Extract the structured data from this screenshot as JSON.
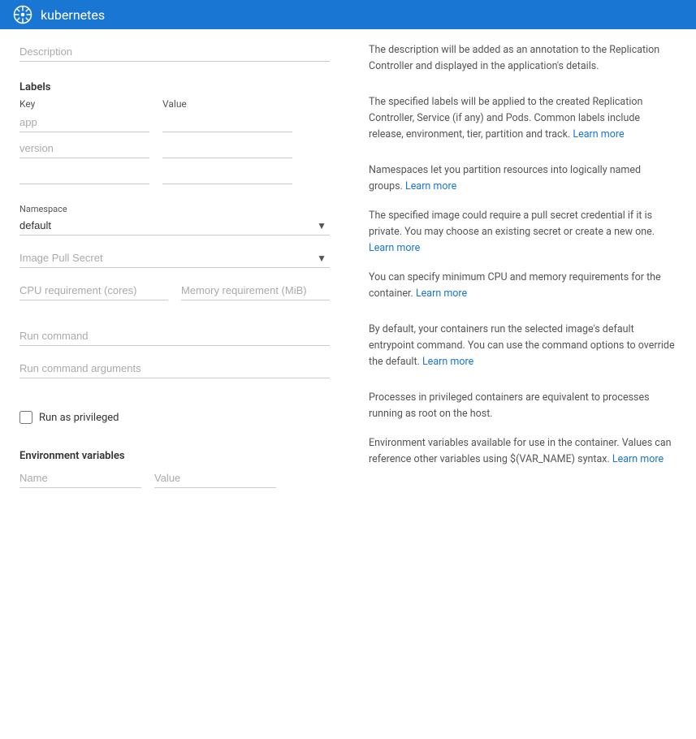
{
  "header": {
    "logo_alt": "Kubernetes logo",
    "title": "kubernetes"
  },
  "form": {
    "description_placeholder": "Description",
    "labels": {
      "section_label": "Labels",
      "key_header": "Key",
      "value_header": "Value",
      "row1_key_placeholder": "app",
      "row1_value_placeholder": "",
      "row2_key_placeholder": "version",
      "row2_value_placeholder": "",
      "row3_key_placeholder": "",
      "row3_value_placeholder": ""
    },
    "namespace": {
      "label": "Namespace",
      "selected": "default",
      "options": [
        "default"
      ]
    },
    "image_pull_secret": {
      "placeholder": "Image Pull Secret",
      "options": []
    },
    "cpu_placeholder": "CPU requirement (cores)",
    "memory_placeholder": "Memory requirement (MiB)",
    "run_command_placeholder": "Run command",
    "run_command_args_placeholder": "Run command arguments",
    "run_as_privileged_label": "Run as privileged",
    "run_as_privileged_checked": false,
    "env_vars": {
      "section_label": "Environment variables",
      "name_placeholder": "Name",
      "value_placeholder": "Value"
    }
  },
  "help": {
    "description_text": "The description will be added as an annotation to the Replication Controller and displayed in the application's details.",
    "labels_text": "The specified labels will be applied to the created Replication Controller, Service (if any) and Pods. Common labels include release, environment, tier, partition and track.",
    "labels_link_text": "Learn more",
    "labels_link_href": "#",
    "namespace_text": "Namespaces let you partition resources into logically named groups.",
    "namespace_link_text": "Learn more",
    "namespace_link_href": "#",
    "pull_secret_text": "The specified image could require a pull secret credential if it is private. You may choose an existing secret or create a new one.",
    "pull_secret_link_text": "Learn more",
    "pull_secret_link_href": "#",
    "cpu_memory_text": "You can specify minimum CPU and memory requirements for the container.",
    "cpu_memory_link_text": "Learn more",
    "cpu_memory_link_href": "#",
    "run_command_text": "By default, your containers run the selected image's default entrypoint command. You can use the command options to override the default.",
    "run_command_link_text": "Learn more",
    "run_command_link_href": "#",
    "privileged_text": "Processes in privileged containers are equivalent to processes running as root on the host.",
    "env_vars_text": "Environment variables available for use in the container. Values can reference other variables using $(VAR_NAME) syntax.",
    "env_vars_link_text": "Learn more",
    "env_vars_link_href": "#"
  }
}
